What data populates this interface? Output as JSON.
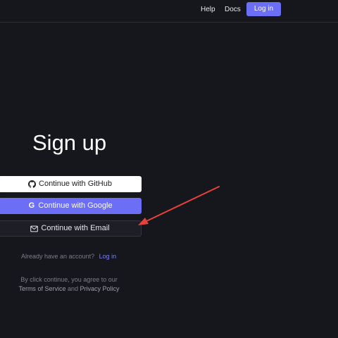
{
  "header": {
    "help_label": "Help",
    "docs_label": "Docs",
    "login_label": "Log in"
  },
  "main": {
    "title": "Sign up",
    "github_label": "Continue with GitHub",
    "google_label": "Continue with Google",
    "email_label": "Continue with Email",
    "already_text": "Already have an account?",
    "login_link": "Log in",
    "terms_line1": "By click continue, you agree to our",
    "terms_of_service": "Terms of Service",
    "terms_and": "and",
    "privacy_policy": "Privacy Policy"
  },
  "icons": {
    "github": "github-icon",
    "google": "google-icon",
    "email": "mail-icon",
    "google_glyph": "G"
  },
  "colors": {
    "background": "#16161d",
    "accent": "#6c6ff5",
    "annotation_arrow": "#e8413a"
  }
}
